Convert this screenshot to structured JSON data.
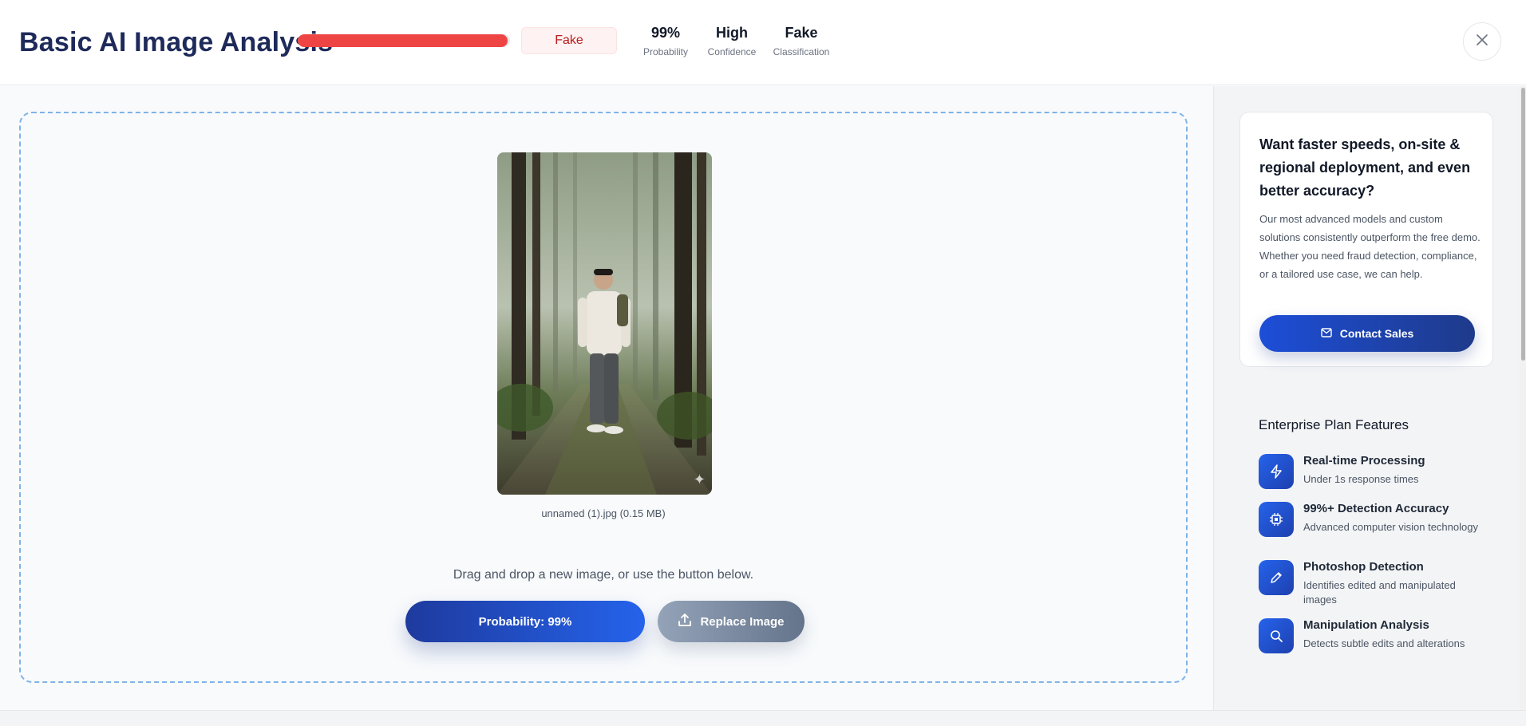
{
  "header": {
    "title": "Basic AI Image Analysis",
    "probability_fill": 0.99,
    "verdict": "Fake",
    "stats": [
      {
        "value": "99%",
        "label": "Probability"
      },
      {
        "value": "High",
        "label": "Confidence"
      },
      {
        "value": "Fake",
        "label": "Classification"
      }
    ],
    "close_icon": "close-icon"
  },
  "main": {
    "filename": "unnamed (1).jpg (0.15 MB)",
    "drag_hint": "Drag and drop a new image, or use the button below.",
    "probability_button": "Probability: 99%",
    "replace_button": "Replace Image",
    "replace_icon": "upload-icon"
  },
  "sidebar": {
    "promo": {
      "title": "Want faster speeds, on-site & regional deployment, and even better accuracy?",
      "body": "Our most advanced models and custom solutions consistently outperform the free demo. Whether you need fraud detection, compliance, or a tailored use case, we can help.",
      "button": "Contact Sales",
      "button_icon": "mail-icon"
    },
    "features_title": "Enterprise Plan Features",
    "features": [
      {
        "icon": "lightning-icon",
        "title": "Real-time Processing",
        "desc": "Under 1s response times"
      },
      {
        "icon": "chip-icon",
        "title": "99%+ Detection Accuracy",
        "desc": "Advanced computer vision technology"
      },
      {
        "icon": "pencil-icon",
        "title": "Photoshop Detection",
        "desc": "Identifies edited and manipulated images"
      },
      {
        "icon": "search-icon",
        "title": "Manipulation Analysis",
        "desc": "Detects subtle edits and alterations"
      }
    ]
  },
  "colors": {
    "brand_dark": "#1e2a5a",
    "accent_blue": "#2563eb",
    "fake_red": "#ef4444",
    "dropzone_border": "#7fb3e8"
  }
}
